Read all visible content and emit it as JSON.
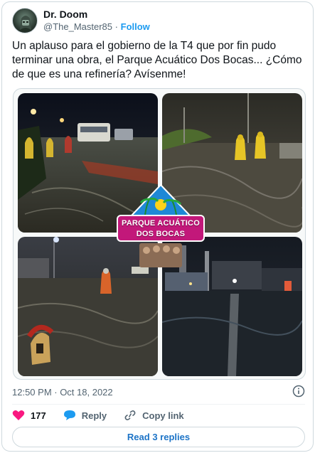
{
  "author": {
    "display_name": "Dr. Doom",
    "handle": "@The_Master85",
    "separator": "·",
    "follow_label": "Follow"
  },
  "tweet": {
    "text": "Un aplauso para el gobierno de la T4 que por fin pudo terminar una obra, el Parque Acuático Dos Bocas... ¿Cómo de que es una refinería? Avísenme!",
    "logo_line1": "PARQUE ACUÁTICO",
    "logo_line2": "DOS BOCAS",
    "timestamp": "12:50 PM · Oct 18, 2022"
  },
  "actions": {
    "like_count": "177",
    "reply_label": "Reply",
    "copy_label": "Copy link"
  },
  "footer": {
    "read_replies_label": "Read 3 replies"
  },
  "colors": {
    "accent": "#1d9bf0",
    "like": "#f91880",
    "logo_banner": "#c2187a"
  },
  "icons": [
    "avatar",
    "heart-icon",
    "reply-icon",
    "link-icon",
    "info-icon",
    "sun-icon",
    "palm-icon",
    "spartan-helmet-icon"
  ]
}
